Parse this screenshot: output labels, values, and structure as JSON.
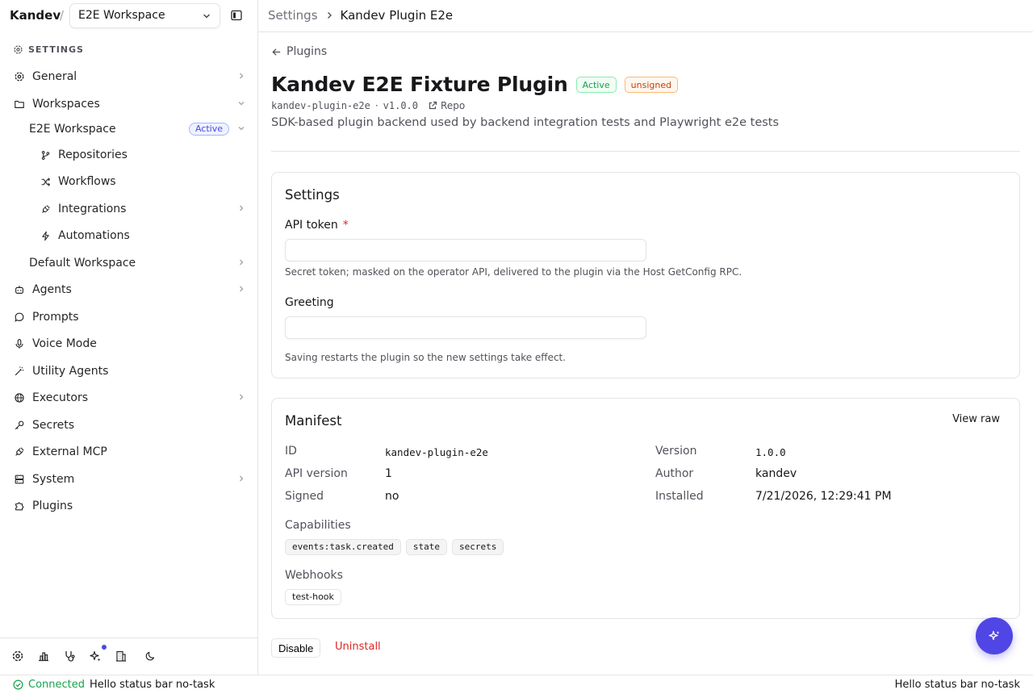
{
  "sidebar": {
    "brand": "Kandev",
    "slash": "/",
    "workspace_select": "E2E Workspace",
    "section_heading": "SETTINGS",
    "items": {
      "general": "General",
      "workspaces": "Workspaces",
      "e2e_workspace": "E2E Workspace",
      "e2e_active_badge": "Active",
      "repositories": "Repositories",
      "workflows": "Workflows",
      "integrations": "Integrations",
      "automations": "Automations",
      "default_workspace": "Default Workspace",
      "agents": "Agents",
      "prompts": "Prompts",
      "voice_mode": "Voice Mode",
      "utility_agents": "Utility Agents",
      "executors": "Executors",
      "secrets": "Secrets",
      "external_mcp": "External MCP",
      "system": "System",
      "plugins": "Plugins"
    }
  },
  "header": {
    "crumb_root": "Settings",
    "crumb_current": "Kandev Plugin E2e"
  },
  "page": {
    "back_label": "Plugins",
    "title": "Kandev E2E Fixture Plugin",
    "status_badge": "Active",
    "signature_badge": "unsigned",
    "plugin_slug": "kandev-plugin-e2e",
    "meta_sep": "·",
    "version": "v1.0.0",
    "repo_link": "Repo",
    "description": "SDK-based plugin backend used by backend integration tests and Playwright e2e tests"
  },
  "settings_card": {
    "title": "Settings",
    "api_token_label": "API token",
    "required_mark": "*",
    "api_token_value": "",
    "api_token_help": "Secret token; masked on the operator API, delivered to the plugin via the Host GetConfig RPC.",
    "greeting_label": "Greeting",
    "greeting_value": "",
    "footer_note": "Saving restarts the plugin so the new settings take effect."
  },
  "manifest_card": {
    "title": "Manifest",
    "view_raw": "View raw",
    "id_key": "ID",
    "id_value": "kandev-plugin-e2e",
    "api_version_key": "API version",
    "api_version_value": "1",
    "signed_key": "Signed",
    "signed_value": "no",
    "version_key": "Version",
    "version_value": "1.0.0",
    "author_key": "Author",
    "author_value": "kandev",
    "installed_key": "Installed",
    "installed_value": "7/21/2026, 12:29:41 PM",
    "capabilities_label": "Capabilities",
    "capabilities": [
      "events:task.created",
      "state",
      "secrets"
    ],
    "webhooks_label": "Webhooks",
    "webhooks": [
      "test-hook"
    ]
  },
  "actions": {
    "disable": "Disable",
    "uninstall": "Uninstall"
  },
  "statusbar": {
    "connected": "Connected",
    "left_message": "Hello status bar no-task",
    "right_message": "Hello status bar no-task"
  },
  "colors": {
    "accent": "#4f46e5",
    "success": "#16a34a",
    "danger": "#dc2626",
    "warning": "#c2410c",
    "border": "#e4e4e7"
  }
}
